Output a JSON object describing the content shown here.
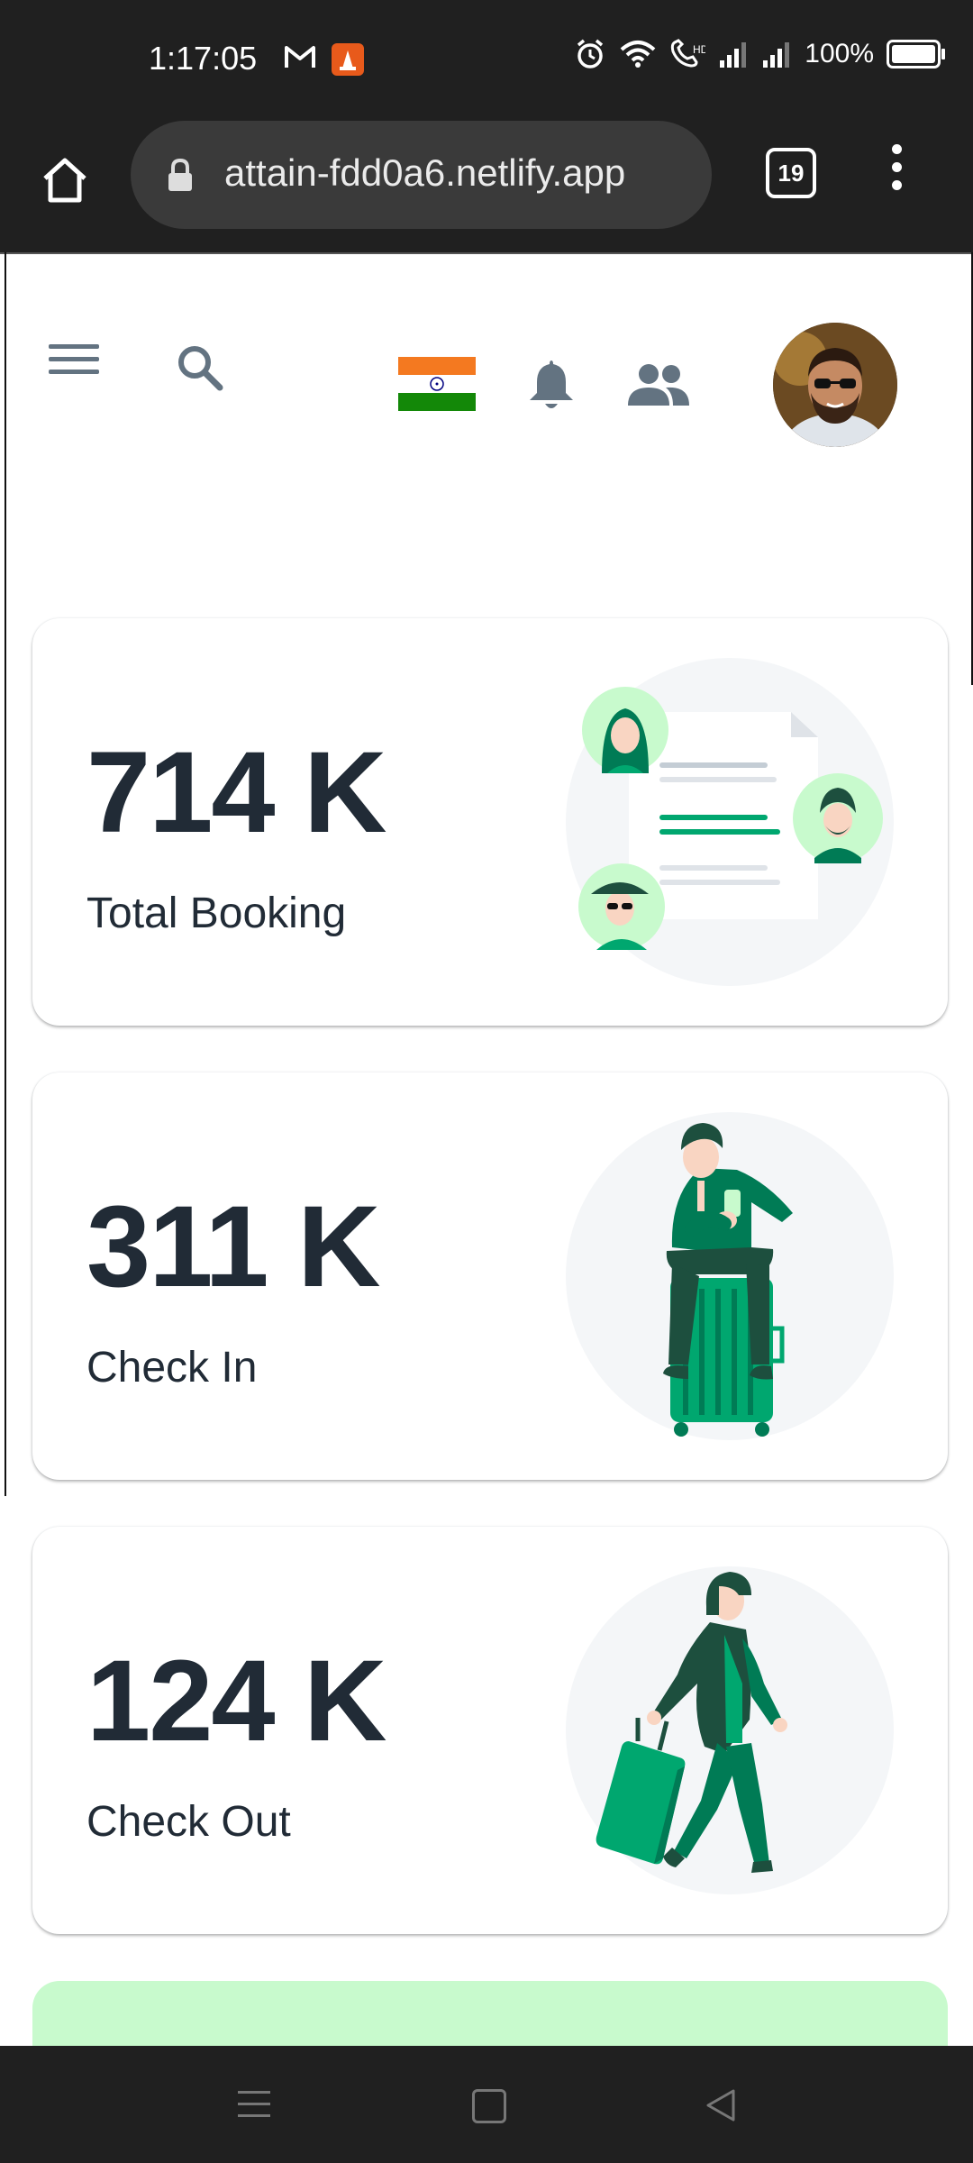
{
  "status_bar": {
    "time": "1:17:05",
    "battery_text": "100%"
  },
  "browser": {
    "url": "attain-fdd0a6.netlify.app",
    "tab_count": "19"
  },
  "header": {
    "flag_icon": "india-flag-icon",
    "icons": [
      "menu-icon",
      "search-icon",
      "bell-icon",
      "people-icon",
      "avatar"
    ]
  },
  "cards": [
    {
      "value": "714 K",
      "label": "Total Booking",
      "illustration": "booking-illustration"
    },
    {
      "value": "311 K",
      "label": "Check In",
      "illustration": "check-in-illustration"
    },
    {
      "value": "124 K",
      "label": "Check Out",
      "illustration": "check-out-illustration"
    }
  ],
  "colors": {
    "primary_green": "#00A76F",
    "dark_green": "#007B55",
    "light_green": "#C8FACD",
    "text_dark": "#212B36",
    "icon_grey": "#637381"
  }
}
